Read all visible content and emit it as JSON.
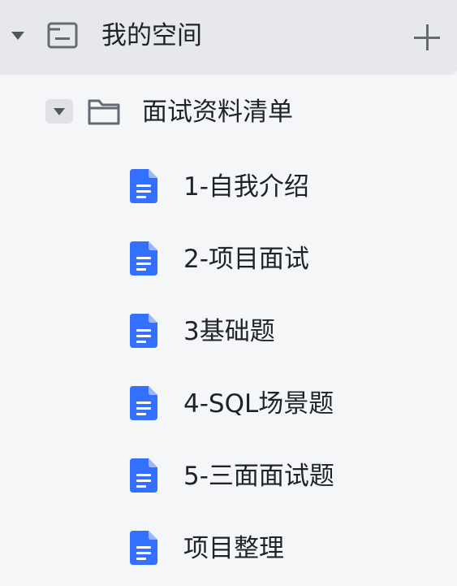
{
  "space": {
    "label": "我的空间",
    "icon": "space-icon",
    "expanded": true,
    "add_icon": "plus-icon"
  },
  "folder": {
    "label": "面试资料清单",
    "icon": "folder-icon",
    "expanded": true
  },
  "docs": [
    {
      "label": "1-自我介绍",
      "icon": "doc-icon"
    },
    {
      "label": "2-项目面试",
      "icon": "doc-icon"
    },
    {
      "label": "3基础题",
      "icon": "doc-icon"
    },
    {
      "label": "4-SQL场景题",
      "icon": "doc-icon"
    },
    {
      "label": "5-三面面试题",
      "icon": "doc-icon"
    },
    {
      "label": "项目整理",
      "icon": "doc-icon"
    }
  ],
  "colors": {
    "doc_icon": "#3370ff",
    "text": "#1f2329",
    "background": "#f5f6f8",
    "selected_row": "#e7e8eb"
  }
}
